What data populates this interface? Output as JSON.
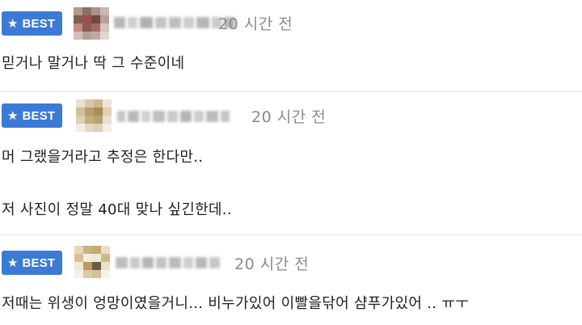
{
  "badge": {
    "label": "BEST",
    "color": "#3b7bd6",
    "icon": "star-icon"
  },
  "comments": [
    {
      "time": "20 시간 전",
      "lines": [
        "믿거나 말거나 딱 그 수준이네"
      ]
    },
    {
      "time": "20 시간 전",
      "lines": [
        "머 그랬을거라고 추정은 한다만..",
        "저 사진이 정말 40대 맞나 싶긴한데.."
      ]
    },
    {
      "time": "20 시간 전",
      "lines": [
        "저때는 위생이 엉망이였을거니... 비누가있어 이빨을닦어 샴푸가있어 .. ㅠㅜ"
      ]
    }
  ]
}
